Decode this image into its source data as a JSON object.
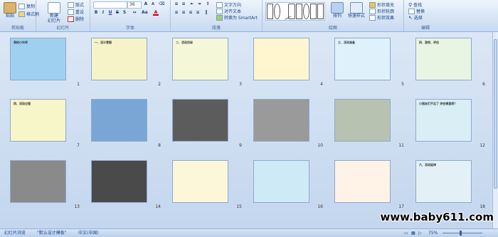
{
  "ribbon": {
    "clipboard": {
      "paste": "粘贴",
      "copy": "复制",
      "format_painter": "格式刷",
      "group": "剪贴板"
    },
    "slides": {
      "new_slide": "新建",
      "new_slide_2": "幻灯片",
      "layout": "版式",
      "reset": "重设",
      "delete": "删除",
      "group": "幻灯片"
    },
    "font": {
      "size": "36",
      "group": "字体"
    },
    "paragraph": {
      "text_direction": "文字方向",
      "align_text": "对齐文本",
      "smartart": "转换为 SmartArt",
      "group": "段落"
    },
    "drawing": {
      "arrange": "排列",
      "quick_styles": "快速样式",
      "fill": "形状填充",
      "outline": "形状轮廓",
      "effects": "形状效果",
      "group": "绘图"
    },
    "editing": {
      "find": "查找",
      "replace": "替换",
      "select": "选择",
      "group": "编辑"
    }
  },
  "slides": [
    {
      "num": "1",
      "title": "我的小伙伴",
      "bg": "#9fd0f0"
    },
    {
      "num": "2",
      "title": "一、设计意图",
      "bg": "#f6f3c8"
    },
    {
      "num": "3",
      "title": "二、活动目标",
      "bg": "#f4f8d8"
    },
    {
      "num": "4",
      "title": "",
      "bg": "#fff6d0"
    },
    {
      "num": "5",
      "title": "三、活动准备",
      "bg": "#dff2fb"
    },
    {
      "num": "6",
      "title": "四、游戏、评估",
      "bg": "#e8f5e2"
    },
    {
      "num": "7",
      "title": "四、活动过程",
      "bg": "#f7f6c8"
    },
    {
      "num": "8",
      "title": "",
      "bg": "#7aa6d6"
    },
    {
      "num": "9",
      "title": "",
      "bg": "#5c5c5c"
    },
    {
      "num": "10",
      "title": "",
      "bg": "#9a9a9a"
    },
    {
      "num": "11",
      "title": "",
      "bg": "#b8c2b0"
    },
    {
      "num": "12",
      "title": "小朋友们不见了 你在哪里呢？",
      "bg": "#d9eef5"
    },
    {
      "num": "13",
      "title": "",
      "bg": "#8a8a8a"
    },
    {
      "num": "14",
      "title": "",
      "bg": "#4a4a4a"
    },
    {
      "num": "15",
      "title": "",
      "bg": "#fbf7d8"
    },
    {
      "num": "16",
      "title": "",
      "bg": "#cfeaf7"
    },
    {
      "num": "17",
      "title": "",
      "bg": "#fff3e8"
    },
    {
      "num": "18",
      "title": "六、活动延伸",
      "bg": "#e3f1f7"
    }
  ],
  "status": {
    "slide_sorter": "幻灯片浏览",
    "theme": "\"默认设计模板\"",
    "language": "中文(中国)",
    "zoom": "75%"
  },
  "watermark": "www.baby611.com"
}
